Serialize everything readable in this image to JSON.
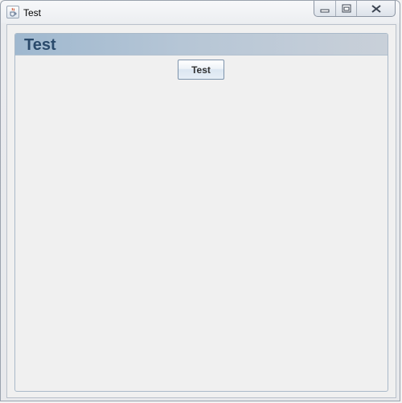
{
  "window": {
    "title": "Test",
    "app_icon": "java-cup-icon",
    "controls": {
      "minimize_icon": "minimize-icon",
      "maximize_icon": "maximize-icon",
      "close_icon": "close-icon"
    }
  },
  "panel": {
    "title": "Test",
    "title_color": "#2a4a6b",
    "header_gradient": [
      "#9fb8cf",
      "#c9d0d9"
    ]
  },
  "button": {
    "label": "Test"
  }
}
